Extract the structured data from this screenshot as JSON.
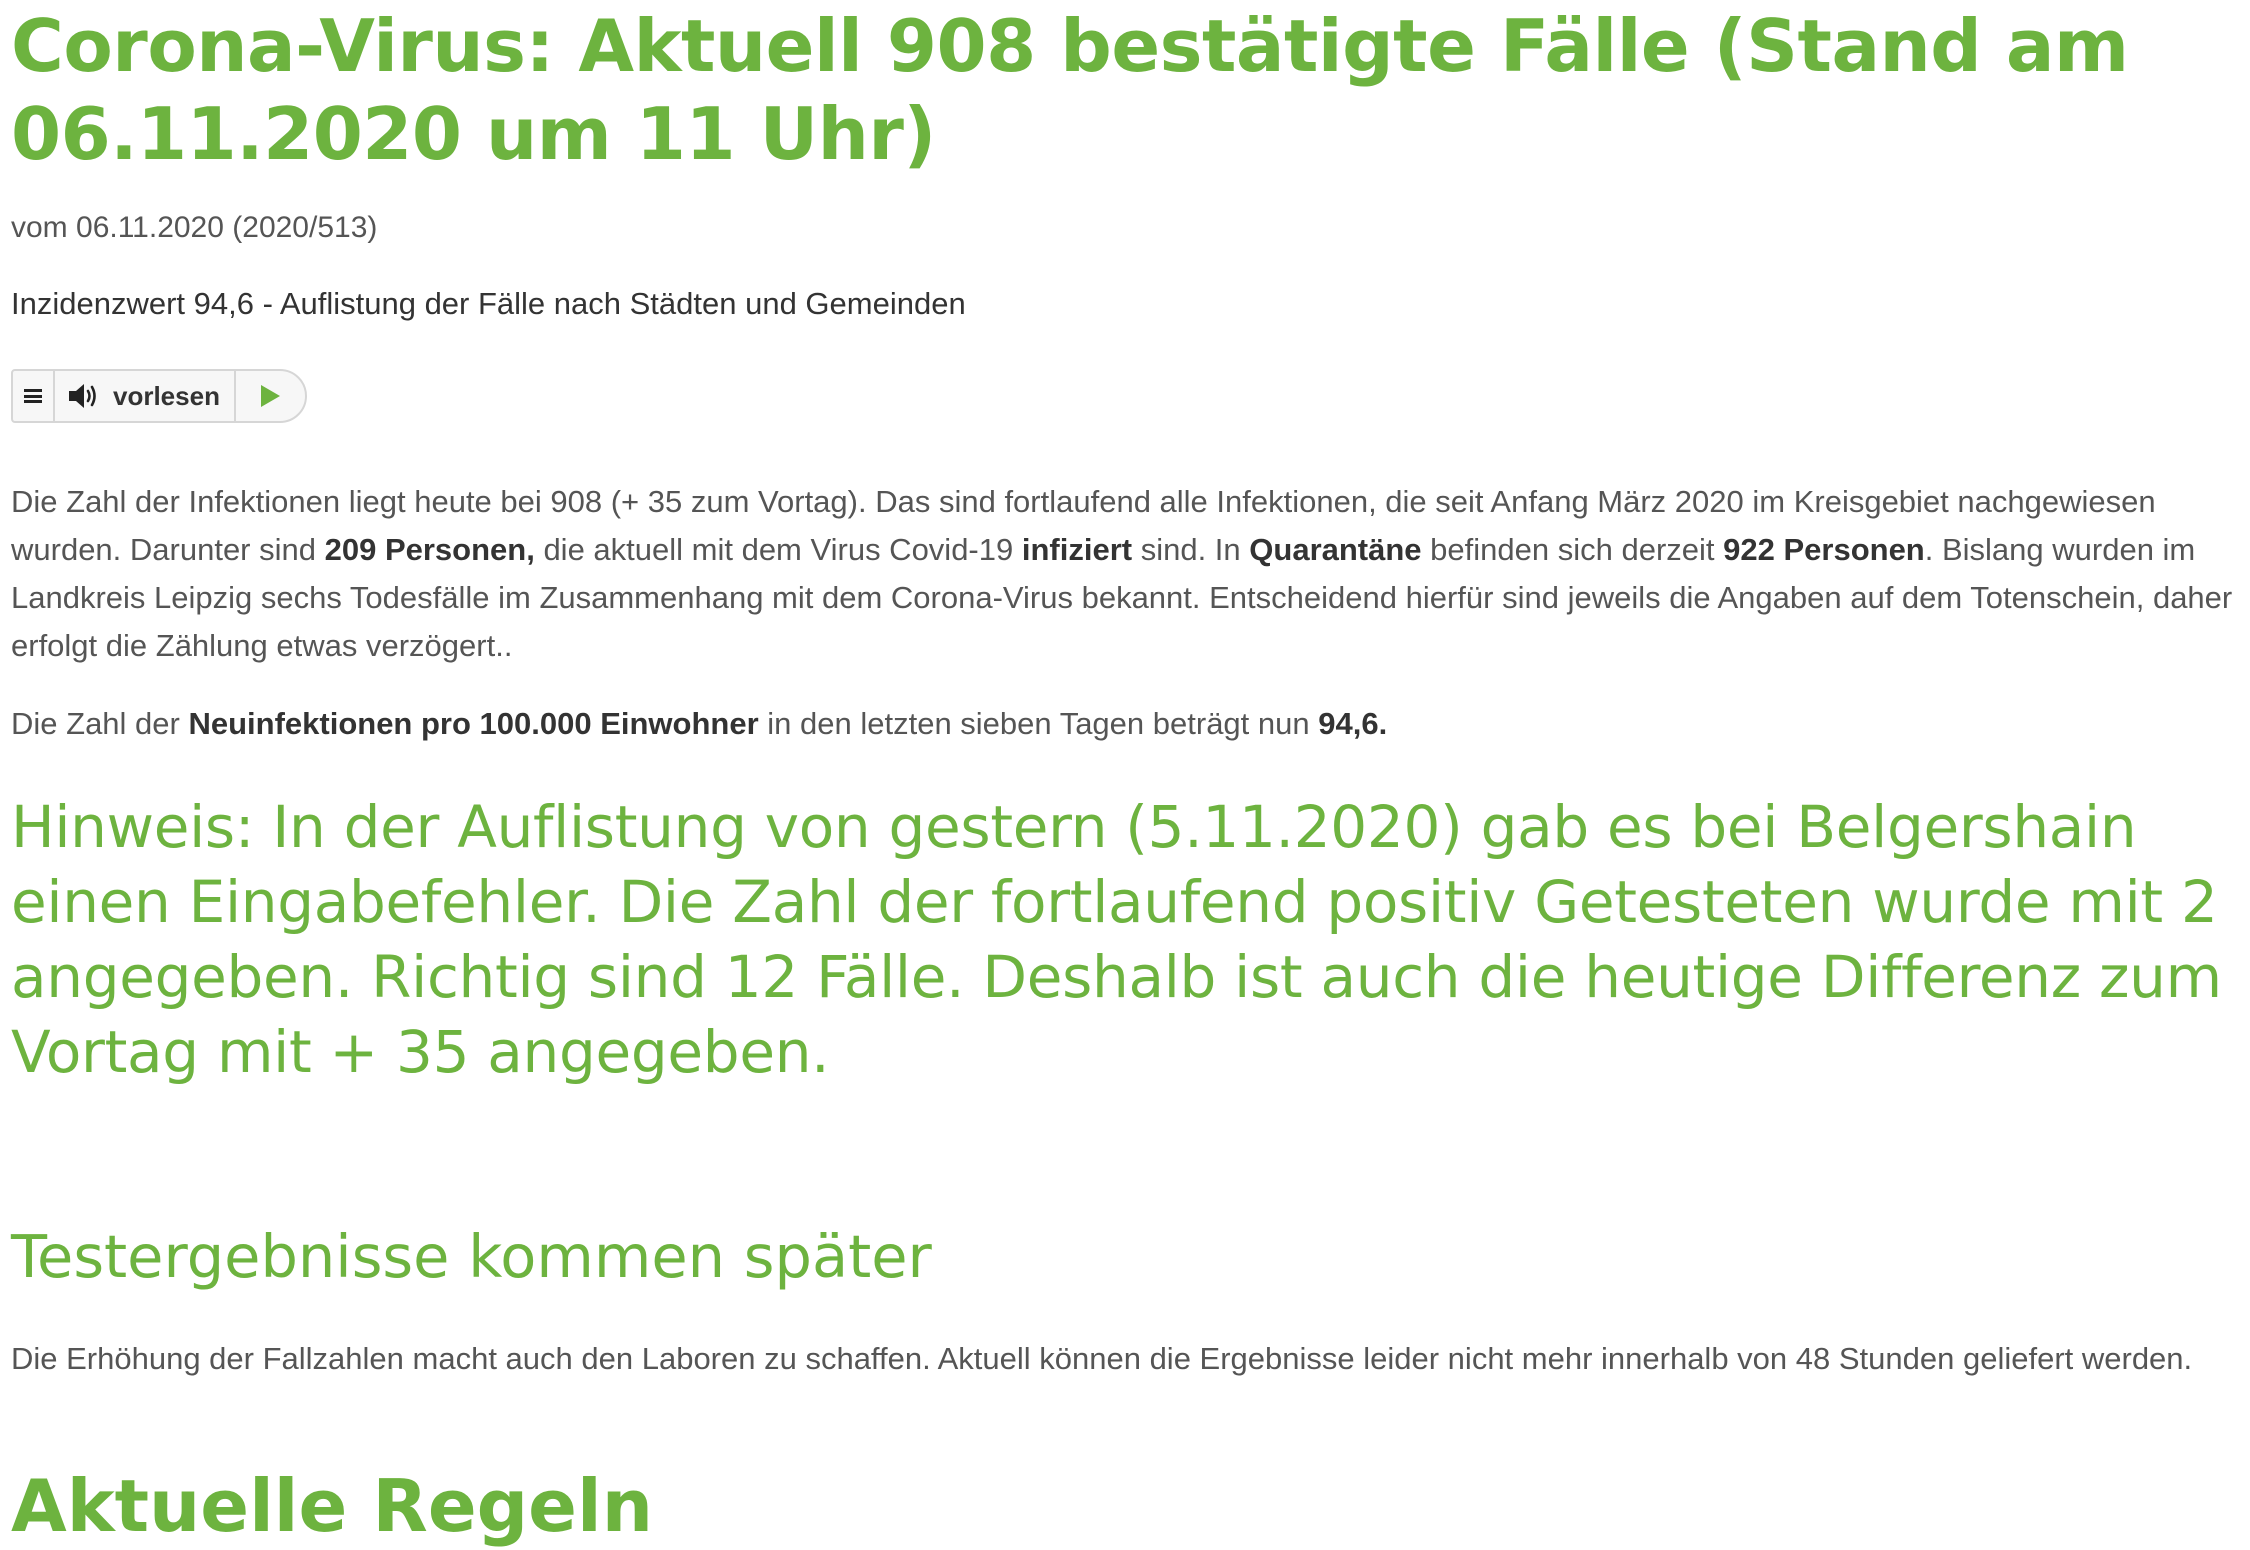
{
  "article": {
    "title": "Corona-Virus: Aktuell 908 bestätigte Fälle (Stand am 06.11.2020 um 11 Uhr)",
    "meta": "vom 06.11.2020 (2020/513)",
    "subtitle": "Inzidenzwert 94,6 - Auflistung der Fälle nach Städten und Gemeinden"
  },
  "readspeaker": {
    "menu_icon": "menu-icon",
    "speaker_icon": "speaker-icon",
    "label": "vorlesen",
    "play_icon": "play-icon",
    "accent": "#6db33f"
  },
  "paragraph1": {
    "t1": "Die Zahl der Infektionen liegt heute bei 908 (+ 35 zum Vortag). Das sind fortlaufend alle Infektionen, die seit Anfang März 2020 im Kreisgebiet nachgewiesen wurden. Darunter sind ",
    "b1": "209 Personen,",
    "t2": " die aktuell mit dem Virus Covid-19 ",
    "b2": "infiziert",
    "t3": " sind. In ",
    "b3": "Quarantäne",
    "t4": " befinden sich derzeit ",
    "b4": "922 Personen",
    "t5": ". Bislang wurden im Landkreis Leipzig sechs Todesfälle im Zusammenhang mit dem Corona-Virus bekannt. Entscheidend hierfür sind jeweils die Angaben auf dem Totenschein, daher erfolgt die Zählung etwas verzögert.."
  },
  "paragraph2": {
    "t1": "Die Zahl der ",
    "b1": "Neuinfektionen pro 100.000 Einwohner",
    "t2": " in den letzten sieben Tagen beträgt nun ",
    "b2": "94,6."
  },
  "notice": "Hinweis: In der Auflistung von gestern (5.11.2020) gab es bei Belgershain einen Eingabefehler. Die Zahl der fortlaufend positiv Getesteten wurde mit 2 angegeben. Richtig sind 12 Fälle. Deshalb ist auch die heutige Differenz zum Vortag mit + 35 angegeben.",
  "section": {
    "heading": "Testergebnisse kommen später",
    "text": "Die Erhöhung der Fallzahlen macht auch den Laboren zu schaffen. Aktuell können die Ergebnisse leider nicht mehr innerhalb von 48 Stunden geliefert werden."
  },
  "next_heading": "Aktuelle Regeln"
}
